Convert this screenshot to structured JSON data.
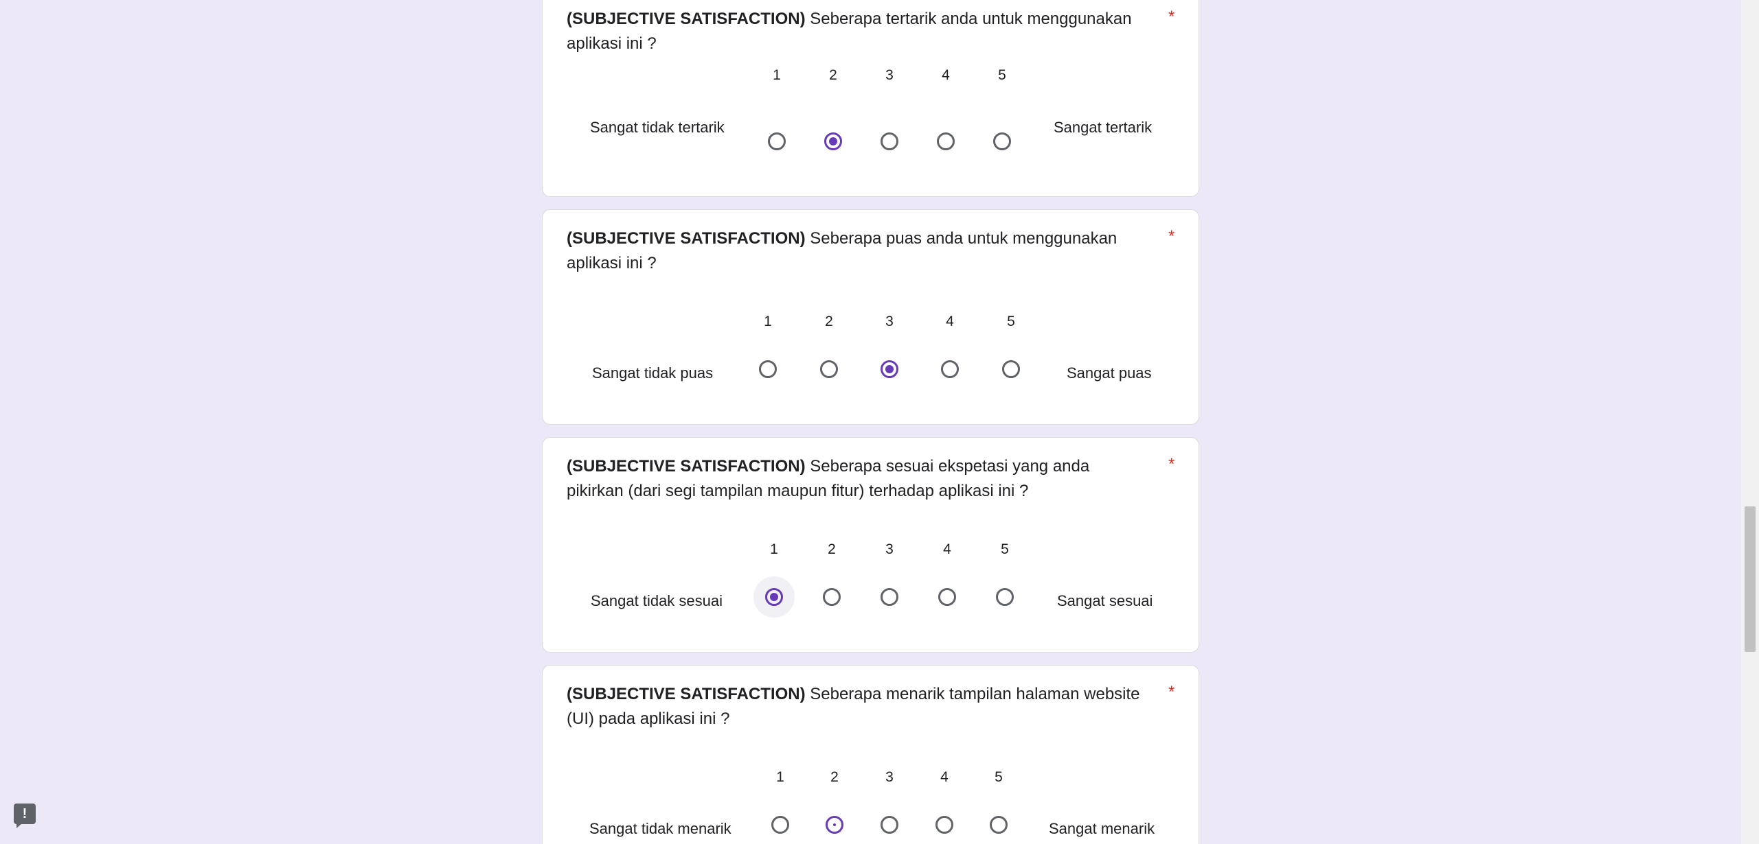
{
  "questions": [
    {
      "tag": "(SUBJECTIVE SATISFACTION)",
      "text": " Seberapa tertarik anda untuk menggunakan aplikasi ini ?",
      "required_mark": "*",
      "scale": [
        "1",
        "2",
        "3",
        "4",
        "5"
      ],
      "low_label": "Sangat tidak tertarik",
      "high_label": "Sangat tertarik",
      "selected": "2"
    },
    {
      "tag": "(SUBJECTIVE SATISFACTION)",
      "text": " Seberapa puas anda untuk menggunakan aplikasi ini ?",
      "required_mark": "*",
      "scale": [
        "1",
        "2",
        "3",
        "4",
        "5"
      ],
      "low_label": "Sangat tidak puas",
      "high_label": "Sangat puas",
      "selected": "3"
    },
    {
      "tag": "(SUBJECTIVE SATISFACTION)",
      "text": " Seberapa sesuai ekspetasi yang anda pikirkan (dari segi tampilan maupun fitur) terhadap aplikasi ini ?",
      "required_mark": "*",
      "scale": [
        "1",
        "2",
        "3",
        "4",
        "5"
      ],
      "low_label": "Sangat tidak sesuai",
      "high_label": "Sangat sesuai",
      "selected": "1"
    },
    {
      "tag": "(SUBJECTIVE SATISFACTION)",
      "text": " Seberapa menarik tampilan halaman website (UI) pada aplikasi ini ?",
      "required_mark": "*",
      "scale": [
        "1",
        "2",
        "3",
        "4",
        "5"
      ],
      "low_label": "Sangat tidak menarik",
      "high_label": "Sangat menarik",
      "selected": ""
    }
  ],
  "feedback_button": {
    "icon": "report-feedback-icon",
    "glyph": "!"
  },
  "colors": {
    "background": "#ede8f7",
    "accent": "#673ab7",
    "required": "#d93025"
  }
}
